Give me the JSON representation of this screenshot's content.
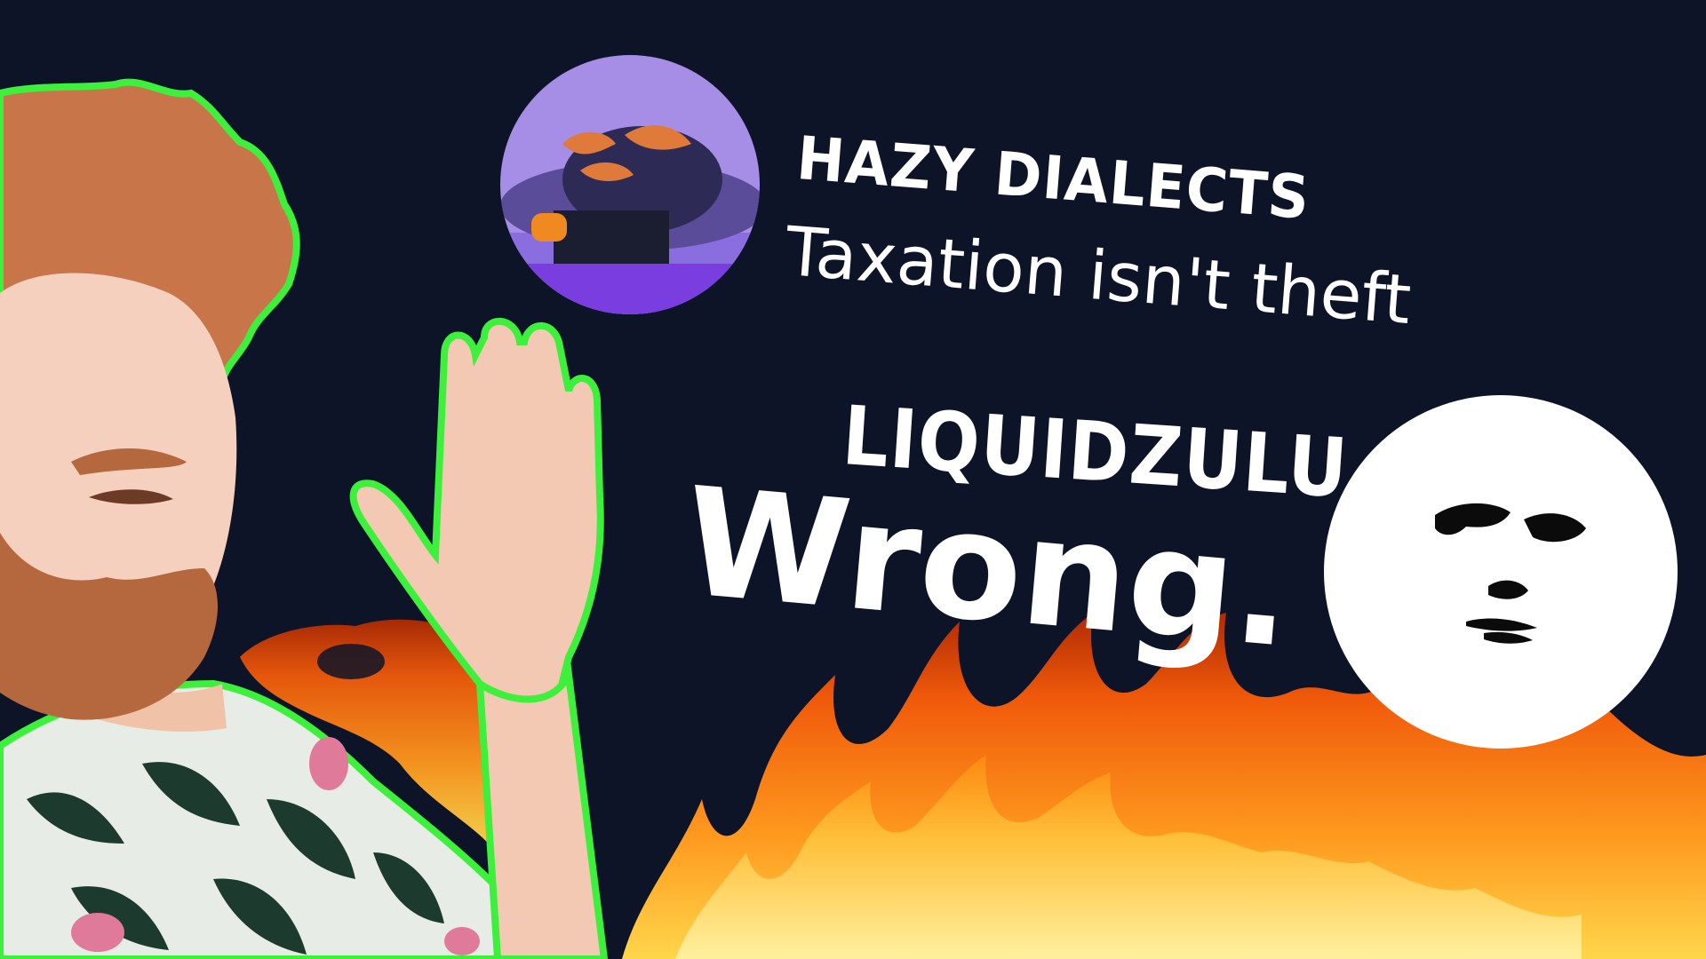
{
  "colors": {
    "background": "#0e1428",
    "outline_green": "#3cf03c",
    "text": "#ffffff",
    "flame_orange": "#ff7a12",
    "flame_yellow": "#ffd64a",
    "avatar_purple": "#a68ee6",
    "face_white": "#ffffff"
  },
  "comments": [
    {
      "username": "HAZY DIALECTS",
      "text": "Taxation isn't theft",
      "avatar": "purple-avatar"
    },
    {
      "username": "LIQUIDZULU",
      "text": "Wrong.",
      "avatar": "white-face-avatar"
    }
  ]
}
